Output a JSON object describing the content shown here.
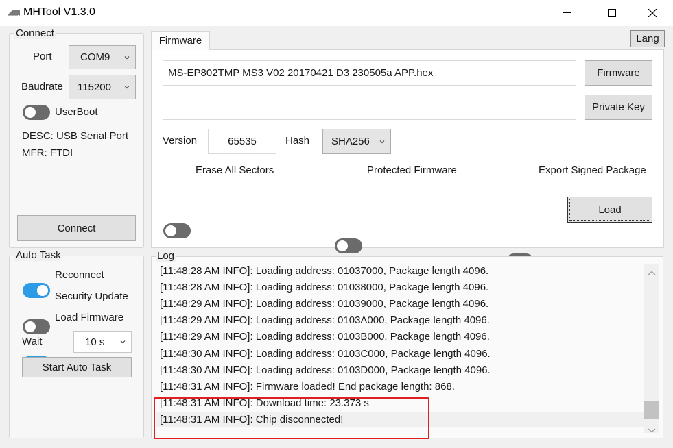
{
  "window": {
    "title": "MHTool V1.3.0"
  },
  "connect": {
    "group_title": "Connect",
    "port_label": "Port",
    "port_value": "COM9",
    "baudrate_label": "Baudrate",
    "baudrate_value": "115200",
    "userboot_label": "UserBoot",
    "userboot_on": false,
    "desc": "DESC: USB Serial Port",
    "mfr": "MFR: FTDI",
    "connect_button": "Connect"
  },
  "auto_task": {
    "group_title": "Auto Task",
    "reconnect_label": "Reconnect",
    "reconnect_on": true,
    "security_update_label": "Security Update",
    "security_update_on": false,
    "load_firmware_label": "Load Firmware",
    "load_firmware_on": true,
    "wait_label": "Wait",
    "wait_value": "10 s",
    "start_button": "Start Auto Task"
  },
  "tabs": [
    {
      "label": "Firmware",
      "active": true
    }
  ],
  "lang_button": "Lang",
  "firmware": {
    "file_value": "MS-EP802TMP MS3 V02 20170421 D3 230505a APP.hex",
    "firmware_button": "Firmware",
    "key_value": "",
    "private_key_button": "Private Key",
    "version_label": "Version",
    "version_value": "65535",
    "hash_label": "Hash",
    "hash_value": "SHA256",
    "erase_label": "Erase All Sectors",
    "erase_on": false,
    "protected_label": "Protected Firmware",
    "protected_on": false,
    "export_label": "Export Signed Package",
    "export_on": false,
    "load_button": "Load"
  },
  "log": {
    "title": "Log",
    "lines": [
      "[11:48:28 AM INFO]: Loading address: 01037000, Package length 4096.",
      "[11:48:28 AM INFO]: Loading address: 01038000, Package length 4096.",
      "[11:48:29 AM INFO]: Loading address: 01039000, Package length 4096.",
      "[11:48:29 AM INFO]: Loading address: 0103A000, Package length 4096.",
      "[11:48:29 AM INFO]: Loading address: 0103B000, Package length 4096.",
      "[11:48:30 AM INFO]: Loading address: 0103C000, Package length 4096.",
      "[11:48:30 AM INFO]: Loading address: 0103D000, Package length 4096.",
      "[11:48:31 AM INFO]: Firmware loaded! End package length: 868.",
      "[11:48:31 AM INFO]: Download time: 23.373 s",
      "[11:48:31 AM INFO]: Chip disconnected!"
    ]
  },
  "icons": {
    "app": "chip-icon",
    "minimize": "minimize-icon",
    "maximize": "maximize-icon",
    "close": "close-icon",
    "dropdown": "chevron-down-icon",
    "scroll_up": "scroll-up-icon",
    "scroll_down": "scroll-down-icon"
  },
  "colors": {
    "toggle_on": "#2e9be6",
    "toggle_off": "#6b6b6b",
    "highlight_box": "#e0201e"
  }
}
